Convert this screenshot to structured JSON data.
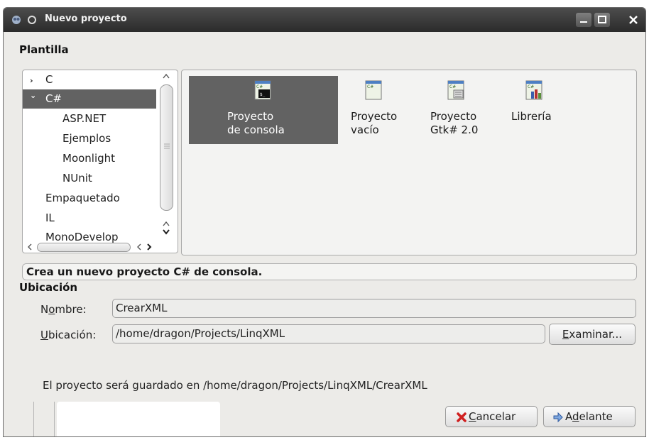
{
  "window": {
    "title": "Nuevo proyecto",
    "controls": [
      "minimize-icon",
      "maximize-icon",
      "close-icon"
    ]
  },
  "template_section": {
    "label": "Plantilla",
    "categories": [
      {
        "label": "C",
        "arrow": "›",
        "expanded": false,
        "selected": false
      },
      {
        "label": "C#",
        "arrow": "⌄",
        "expanded": true,
        "selected": true
      },
      {
        "label": "ASP.NET",
        "child": true
      },
      {
        "label": "Ejemplos",
        "child": true
      },
      {
        "label": "Moonlight",
        "child": true
      },
      {
        "label": "NUnit",
        "child": true
      },
      {
        "label": "Empaquetado"
      },
      {
        "label": "IL"
      },
      {
        "label": "MonoDevelop"
      }
    ],
    "templates": [
      {
        "line1": "Proyecto",
        "line2": "de consola",
        "icon": "csharp-console-icon",
        "selected": true
      },
      {
        "line1": "Proyecto",
        "line2": "vacío",
        "icon": "csharp-empty-icon",
        "selected": false
      },
      {
        "line1": "Proyecto",
        "line2": "Gtk# 2.0",
        "icon": "csharp-gtk-icon",
        "selected": false
      },
      {
        "line1": "Librería",
        "line2": "",
        "icon": "csharp-library-icon",
        "selected": false
      }
    ],
    "description": "Crea un nuevo proyecto C# de consola."
  },
  "location_section": {
    "label": "Ubicación",
    "name_label": "Nombre:",
    "name_label_mnemonic": "o",
    "name_value": "CrearXML",
    "location_label": "Ubicación:",
    "location_label_mnemonic": "U",
    "location_value": "/home/dragon/Projects/LinqXML",
    "browse_button": "Examinar...",
    "saved_text": "El proyecto será guardado en /home/dragon/Projects/LinqXML/CrearXML"
  },
  "buttons": {
    "cancel": "Cancelar",
    "forward": "Adelante"
  },
  "colors": {
    "titlebar": "#2b2b2b",
    "selection": "#626262",
    "window_bg": "#ecebe8"
  }
}
